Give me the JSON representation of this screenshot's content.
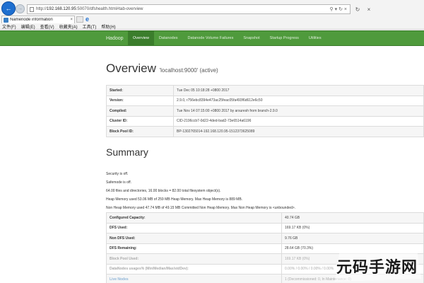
{
  "browser": {
    "url_prefix": "http://",
    "url_host": "192.168.120.95",
    "url_rest": ":50070/dfshealth.html#tab-overview",
    "tab_title": "Namenode information",
    "menu": [
      "文件(F)",
      "编辑(E)",
      "查看(V)",
      "收藏夹(A)",
      "工具(T)",
      "帮助(H)"
    ]
  },
  "navbar": {
    "brand": "Hadoop",
    "items": [
      "Overview",
      "Datanodes",
      "Datanode Volume Failures",
      "Snapshot",
      "Startup Progress",
      "Utilities"
    ]
  },
  "overview": {
    "title": "Overview",
    "subtitle": "'localhost:9000' (active)",
    "rows": [
      {
        "key": "Started:",
        "value": "Tue Dec 05 10:18:28 +0800 2017"
      },
      {
        "key": "Version:",
        "value": "2.9.0, r756ebc8394e473ac25feac05fa493f6d612e6c50"
      },
      {
        "key": "Compiled:",
        "value": "Tue Nov 14 07:15:00 +0800 2017 by arsuresh from branch-2.9.0"
      },
      {
        "key": "Cluster ID:",
        "value": "CID-2196ccb7-0d22-4ded-bad2-73e6514a6196"
      },
      {
        "key": "Block Pool ID:",
        "value": "BP-1302765014-192.168.120.95-1512373625089"
      }
    ]
  },
  "summary": {
    "title": "Summary",
    "lines": [
      "Security is off.",
      "Safemode is off.",
      "64.00 files and directories, 16.00 blocks = 82.00 total filesystem object(s).",
      "Heap Memory used 53.06 MB of 259 MB Heap Memory. Max Heap Memory is 889 MB.",
      "Non Heap Memory used 47.74 MB of 49.15 MB Committed Non Heap Memory. Max Non Heap Memory is <unbounded>."
    ],
    "rows": [
      {
        "key": "Configured Capacity:",
        "value": "40.74 GB"
      },
      {
        "key": "DFS Used:",
        "value": "169.17 KB (0%)"
      },
      {
        "key": "Non DFS Used:",
        "value": "9.76 GB"
      },
      {
        "key": "DFS Remaining:",
        "value": "28.64 GB (70.3%)"
      },
      {
        "key": "Block Pool Used:",
        "value": "169.17 KB (0%)"
      },
      {
        "key": "DataNodes usages% (Min/Median/Max/stdDev):",
        "value": "0.00% / 0.00% / 0.00% / 0.00%"
      },
      {
        "key": "Live Nodes",
        "value": "1 (Decommissioned: 0, In Maintenance: 0)"
      }
    ]
  },
  "watermark": {
    "text": "元码手游网"
  }
}
